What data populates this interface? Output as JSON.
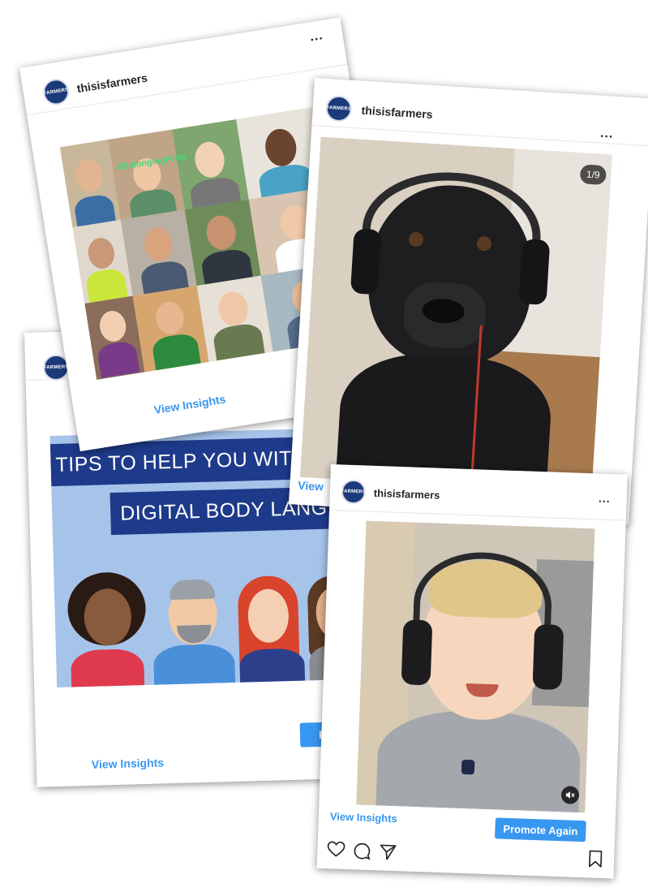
{
  "account": {
    "username": "thisisfarmers",
    "avatar_text": "FARMERS"
  },
  "menu_icon": "more-horizontal-icon",
  "posts": [
    {
      "id": "collage",
      "more": "...",
      "insights_label": "View Insights",
      "overlay_text": "#BelongingPride"
    },
    {
      "id": "body-language",
      "insights_label": "View Insights",
      "promote_label": "Pr",
      "banner_line1": "TIPS TO HELP YOU WIT",
      "banner_line2": "DIGITAL BODY LANG"
    },
    {
      "id": "dog",
      "more": "...",
      "counter": "1/9",
      "insights_label": "View"
    },
    {
      "id": "baby",
      "more": "...",
      "insights_label": "View Insights",
      "promote_label": "Promote Again"
    }
  ],
  "action_icons": [
    "heart-icon",
    "comment-icon",
    "share-icon",
    "bookmark-icon",
    "mute-icon"
  ],
  "colors": {
    "link": "#3897f0",
    "banner": "#1e3a8a",
    "brand": "#1b3a7a"
  }
}
